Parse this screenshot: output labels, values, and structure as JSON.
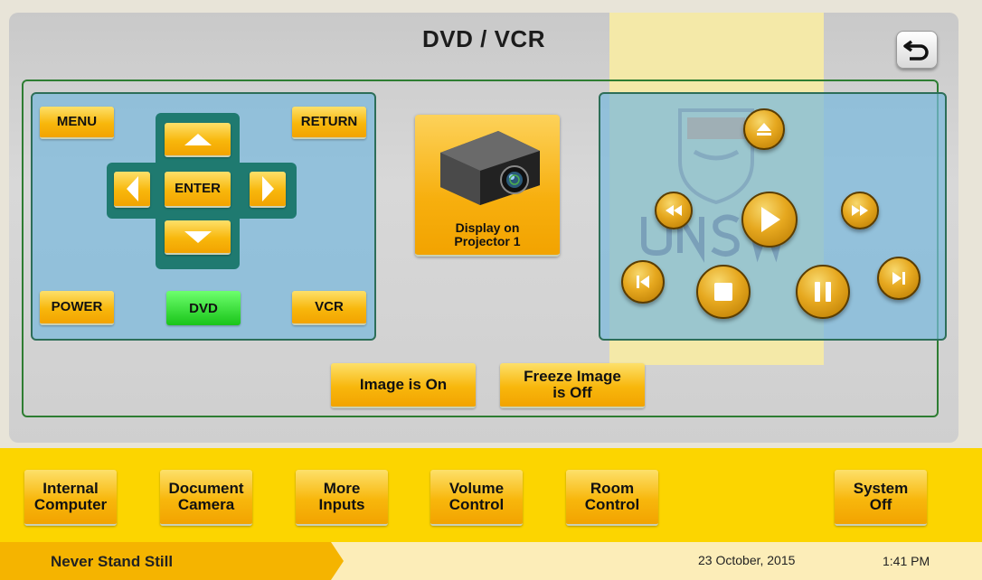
{
  "header": {
    "title": "DVD / VCR",
    "back_icon": "return-arrow-icon"
  },
  "dvd_controls": {
    "menu": "MENU",
    "return": "RETURN",
    "enter": "ENTER",
    "power": "POWER",
    "dvd": "DVD",
    "vcr": "VCR",
    "up_icon": "arrow-up-icon",
    "down_icon": "arrow-down-icon",
    "left_icon": "arrow-left-icon",
    "right_icon": "arrow-right-icon"
  },
  "projector": {
    "label_line1": "Display on",
    "label_line2": "Projector 1",
    "icon": "projector-icon"
  },
  "transport": {
    "eject_icon": "eject-icon",
    "rewind_icon": "rewind-icon",
    "play_icon": "play-icon",
    "fast_forward_icon": "fast-forward-icon",
    "previous_icon": "skip-previous-icon",
    "stop_icon": "stop-icon",
    "pause_icon": "pause-icon",
    "next_icon": "skip-next-icon"
  },
  "image_controls": {
    "image_status": "Image is On",
    "freeze_line1": "Freeze Image",
    "freeze_line2": "is Off"
  },
  "nav": [
    {
      "line1": "Internal",
      "line2": "Computer"
    },
    {
      "line1": "Document",
      "line2": "Camera"
    },
    {
      "line1": "More",
      "line2": "Inputs"
    },
    {
      "line1": "Volume",
      "line2": "Control"
    },
    {
      "line1": "Room",
      "line2": "Control"
    },
    {
      "line1": "System",
      "line2": "Off"
    }
  ],
  "footer": {
    "slogan": "Never Stand Still",
    "date": "23 October, 2015",
    "time": "1:41 PM"
  },
  "colors": {
    "accent_yellow": "#fcd500",
    "button_orange": "#f8b70c",
    "active_green": "#19c419",
    "panel_blue": "#78b8dc",
    "frame_green": "#2e7d32",
    "dpad_teal": "#1f7a70",
    "footer_orange": "#f5b400"
  }
}
